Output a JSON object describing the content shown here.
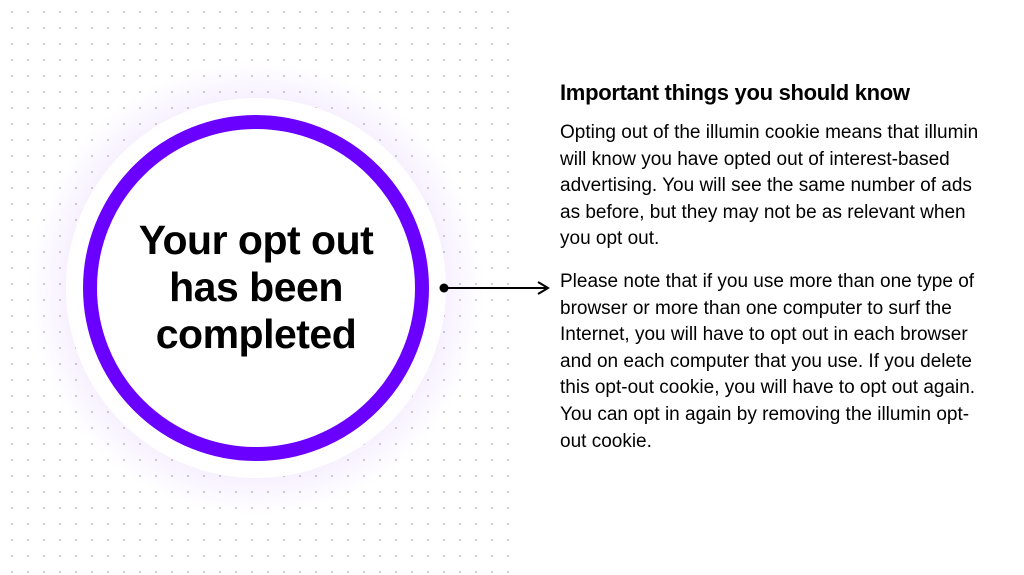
{
  "circle": {
    "title_line1": "Your opt out",
    "title_line2": "has been",
    "title_line3": "completed"
  },
  "info": {
    "heading": "Important things you should know",
    "para1": "Opting out of the illumin cookie means that illumin will know you have opted out of interest-based advertising. You will see the same number of ads as before, but they may not be as relevant when you opt out.",
    "para2": "Please note that if you use more than one type of browser or more than one computer to surf the Internet, you will have to opt out in each browser and on each computer that you use. If you delete this opt-out cookie, you will have to opt out again. You can opt in again by removing the illumin opt-out cookie."
  },
  "colors": {
    "accent": "#6a00ff"
  }
}
